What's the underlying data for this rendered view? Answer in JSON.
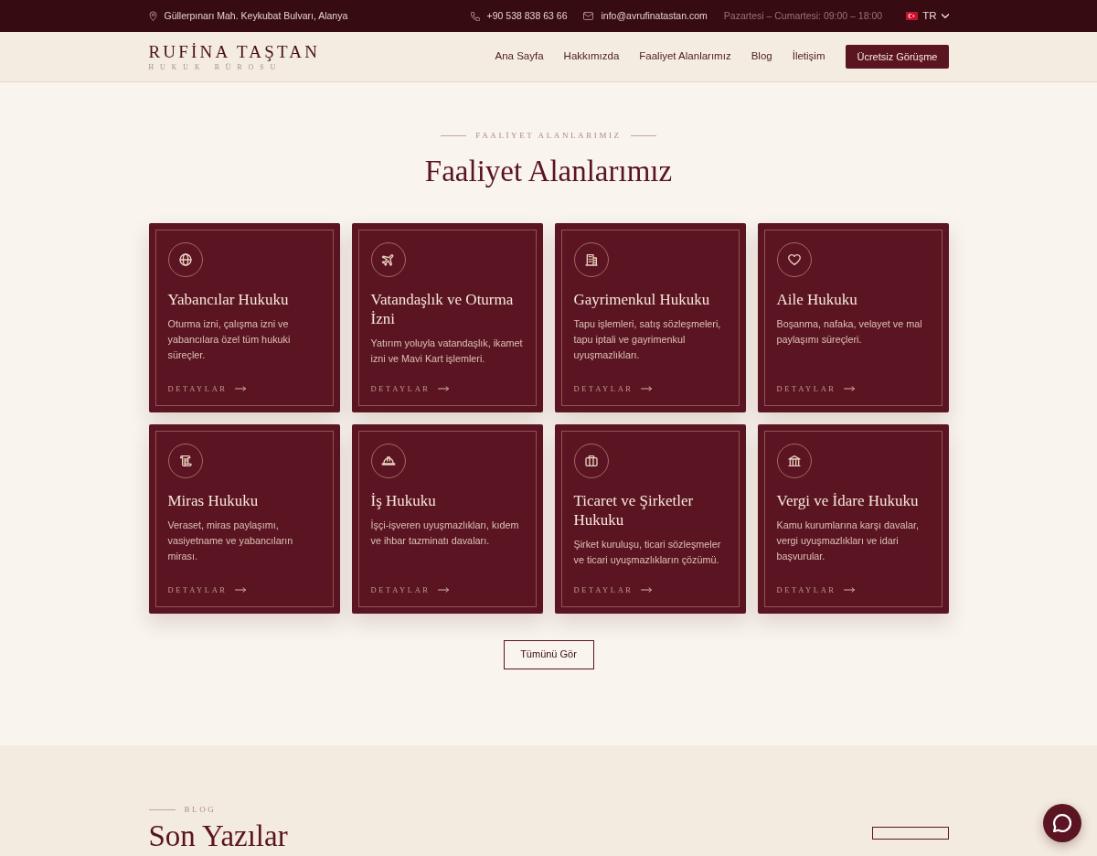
{
  "top_bar": {
    "address": "Güllerpınarı Mah. Keykubat Bulvarı, Alanya",
    "phone": "+90 538 838 63 66",
    "email": "info@avrufinatastan.com",
    "hours": "Pazartesi – Cumartesi: 09:00 – 18:00",
    "language": "TR"
  },
  "navbar": {
    "brand": {
      "name": "RUFİNA TAŞTAN",
      "tagline": "HUKUK BÜROSU"
    },
    "links": [
      {
        "label": "Ana Sayfa"
      },
      {
        "label": "Hakkımızda"
      },
      {
        "label": "Faaliyet Alanlarımız"
      },
      {
        "label": "Blog"
      },
      {
        "label": "İletişim"
      }
    ],
    "cta": "Ücretsiz Görüşme"
  },
  "services_section": {
    "eyebrow": "FAALİYET ALANLARIMIZ",
    "title": "Faaliyet Alanlarımız",
    "cards": [
      {
        "title": "Yabancılar Hukuku",
        "description": "Oturma izni, çalışma izni ve yabancılara özel tüm hukuki süreçler.",
        "link": "DETAYLAR"
      },
      {
        "title": "Vatandaşlık ve Oturma İzni",
        "description": "Yatırım yoluyla vatandaşlık, ikamet izni ve Mavi Kart işlemleri.",
        "link": "DETAYLAR"
      },
      {
        "title": "Gayrimenkul Hukuku",
        "description": "Tapu işlemleri, satış sözleşmeleri, tapu iptali ve gayrimenkul uyuşmazlıkları.",
        "link": "DETAYLAR"
      },
      {
        "title": "Aile Hukuku",
        "description": "Boşanma, nafaka, velayet ve mal paylaşımı süreçleri.",
        "link": "DETAYLAR"
      },
      {
        "title": "Miras Hukuku",
        "description": "Veraset, miras paylaşımı, vasiyetname ve yabancıların mirası.",
        "link": "DETAYLAR"
      },
      {
        "title": "İş Hukuku",
        "description": "İşçi-işveren uyuşmazlıkları, kıdem ve ihbar tazminatı davaları.",
        "link": "DETAYLAR"
      },
      {
        "title": "Ticaret ve Şirketler Hukuku",
        "description": "Şirket kuruluşu, ticari sözleşmeler ve ticari uyuşmazlıkların çözümü.",
        "link": "DETAYLAR"
      },
      {
        "title": "Vergi ve İdare Hukuku",
        "description": "Kamu kurumlarına karşı davalar, vergi uyuşmazlıkları ve idari başvurular.",
        "link": "DETAYLAR"
      }
    ],
    "button": "Tümünü Gör"
  },
  "blog_section": {
    "eyebrow": "BLOG",
    "title": "Son Yazılar"
  }
}
